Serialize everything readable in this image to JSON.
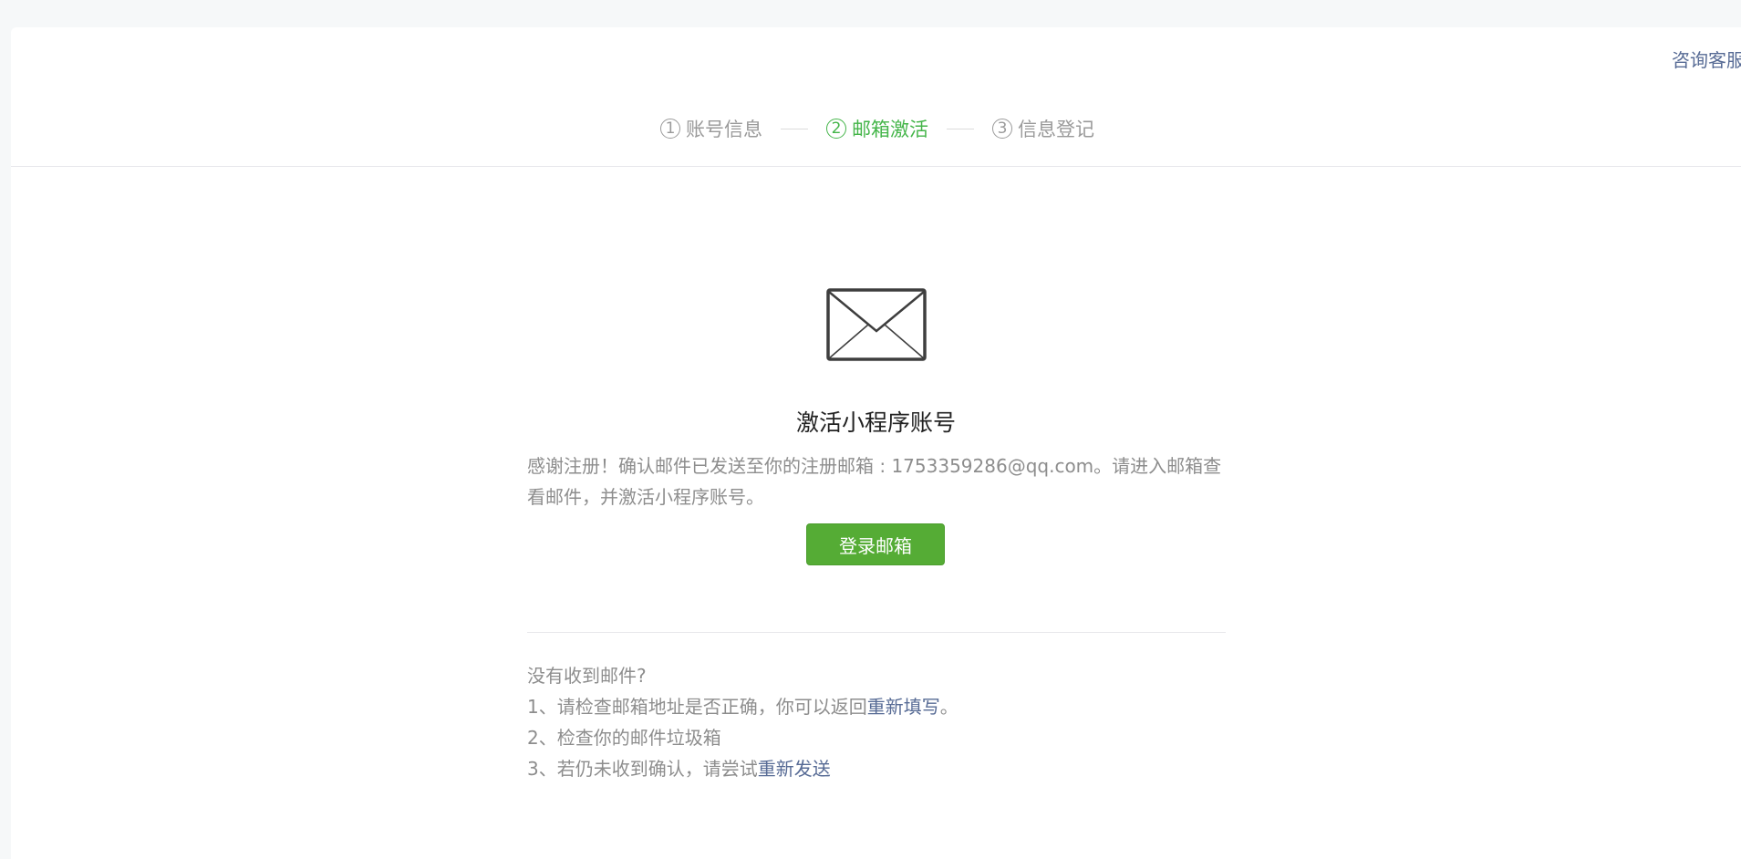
{
  "header": {
    "consult_link": "咨询客服",
    "steps": [
      {
        "num": "1",
        "label": "账号信息",
        "active": false
      },
      {
        "num": "2",
        "label": "邮箱激活",
        "active": true
      },
      {
        "num": "3",
        "label": "信息登记",
        "active": false
      }
    ]
  },
  "main": {
    "icon": "envelope-icon",
    "title": "激活小程序账号",
    "description": "感谢注册！确认邮件已发送至你的注册邮箱 : 1753359286@qq.com。请进入邮箱查看邮件，并激活小程序账号。",
    "login_button": "登录邮箱"
  },
  "help": {
    "heading": "没有收到邮件?",
    "item1_text": "1、请检查邮箱地址是否正确，你可以返回",
    "item1_link": "重新填写",
    "item1_suffix": "。",
    "item2_text": "2、检查你的邮件垃圾箱",
    "item3_text": "3、若仍未收到确认，请尝试",
    "item3_link": "重新发送"
  },
  "colors": {
    "accent_green": "#44b549",
    "button_green": "#55ac35",
    "link_blue": "#576b95",
    "muted_text": "#8d8d8d"
  }
}
